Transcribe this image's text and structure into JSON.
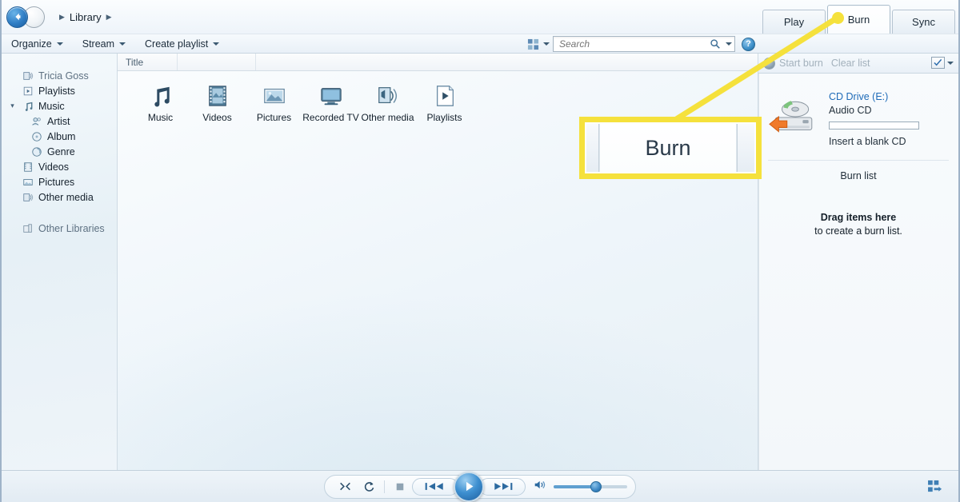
{
  "window": {
    "breadcrumb": [
      "Library"
    ]
  },
  "toolbar": {
    "organize": "Organize",
    "stream": "Stream",
    "create_playlist": "Create playlist",
    "search_placeholder": "Search",
    "view_options_icon": "view-options-icon",
    "search_icon": "search-icon",
    "help_icon": "help-icon"
  },
  "tabs": [
    {
      "label": "Play",
      "active": false,
      "name": "tab-play"
    },
    {
      "label": "Burn",
      "active": true,
      "name": "tab-burn"
    },
    {
      "label": "Sync",
      "active": false,
      "name": "tab-sync"
    }
  ],
  "sidebar": {
    "items": [
      {
        "label": "Tricia Goss",
        "icon": "library-user-icon",
        "indent": 0,
        "muted": true,
        "expander": ""
      },
      {
        "label": "Playlists",
        "icon": "playlist-icon",
        "indent": 0,
        "muted": false,
        "expander": ""
      },
      {
        "label": "Music",
        "icon": "music-note-icon",
        "indent": 0,
        "muted": false,
        "expander": "v"
      },
      {
        "label": "Artist",
        "icon": "artist-icon",
        "indent": 1,
        "muted": false,
        "expander": ""
      },
      {
        "label": "Album",
        "icon": "album-icon",
        "indent": 1,
        "muted": false,
        "expander": ""
      },
      {
        "label": "Genre",
        "icon": "genre-icon",
        "indent": 1,
        "muted": false,
        "expander": ""
      },
      {
        "label": "Videos",
        "icon": "video-icon",
        "indent": 0,
        "muted": false,
        "expander": ""
      },
      {
        "label": "Pictures",
        "icon": "picture-icon",
        "indent": 0,
        "muted": false,
        "expander": ""
      },
      {
        "label": "Other media",
        "icon": "other-media-icon",
        "indent": 0,
        "muted": false,
        "expander": ""
      }
    ],
    "other_libraries": {
      "label": "Other Libraries",
      "icon": "other-libraries-icon"
    }
  },
  "content": {
    "columns": [
      "Title",
      ""
    ],
    "tiles": [
      {
        "label": "Music",
        "icon": "music-note-icon"
      },
      {
        "label": "Videos",
        "icon": "film-strip-icon"
      },
      {
        "label": "Pictures",
        "icon": "photo-icon"
      },
      {
        "label": "Recorded TV",
        "icon": "tv-icon"
      },
      {
        "label": "Other media",
        "icon": "other-media-icon"
      },
      {
        "label": "Playlists",
        "icon": "playlist-page-icon"
      }
    ]
  },
  "burn_panel": {
    "start_burn": "Start burn",
    "clear_list": "Clear list",
    "burn_options_icon": "burn-options-icon",
    "drive_icon": "cd-drive-icon",
    "drive_name": "CD Drive (E:)",
    "drive_type": "Audio CD",
    "drive_hint": "Insert a blank CD",
    "burn_list_label": "Burn list",
    "drag_title": "Drag items here",
    "drag_subtitle": "to create a burn list."
  },
  "callout": {
    "magnified_label": "Burn",
    "highlight_color": "#f5e13c"
  },
  "playback": {
    "shuffle_icon": "shuffle-icon",
    "repeat_icon": "repeat-icon",
    "stop_icon": "stop-icon",
    "previous_icon": "previous-icon",
    "play_icon": "play-icon",
    "next_icon": "next-icon",
    "volume_icon": "volume-icon",
    "switch_to_now_playing_icon": "switch-to-now-playing-icon"
  }
}
